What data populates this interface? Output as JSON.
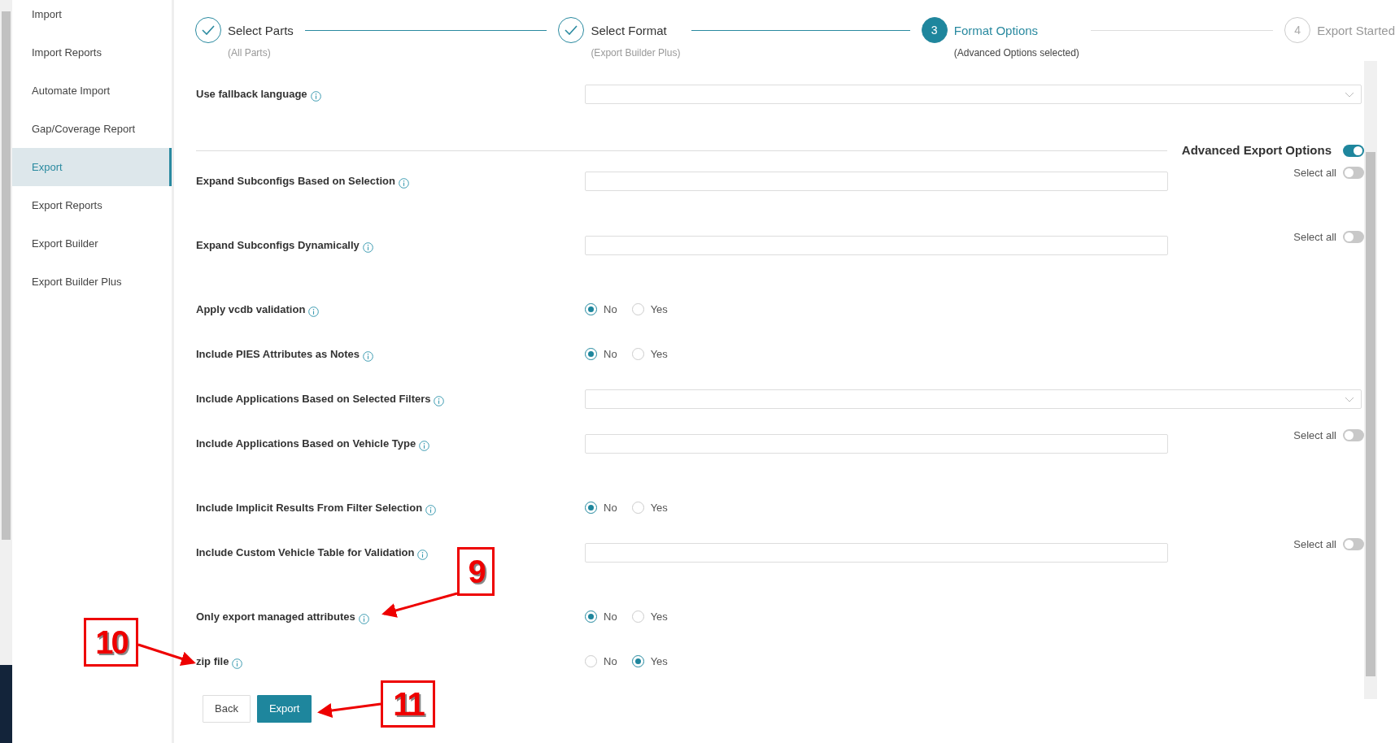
{
  "sidebar": {
    "items": [
      {
        "label": "Import",
        "selected": false
      },
      {
        "label": "Import Reports",
        "selected": false
      },
      {
        "label": "Automate Import",
        "selected": false
      },
      {
        "label": "Gap/Coverage Report",
        "selected": false
      },
      {
        "label": "Export",
        "selected": true
      },
      {
        "label": "Export Reports",
        "selected": false
      },
      {
        "label": "Export Builder",
        "selected": false
      },
      {
        "label": "Export Builder Plus",
        "selected": false
      }
    ]
  },
  "steps": [
    {
      "label": "Select Parts",
      "sublabel": "(All Parts)",
      "kind": "done"
    },
    {
      "label": "Select Format",
      "sublabel": "(Export Builder Plus)",
      "kind": "done"
    },
    {
      "number": "3",
      "label": "Format Options",
      "sublabel": "(Advanced Options selected)",
      "kind": "current"
    },
    {
      "number": "4",
      "label": "Export Started",
      "kind": "todo"
    }
  ],
  "fallback": {
    "label": "Use fallback language",
    "kind": "select"
  },
  "advanced": {
    "label": "Advanced Export Options",
    "on": true
  },
  "options": [
    {
      "label": "Expand Subconfigs Based on Selection",
      "kind": "text",
      "select_all": {
        "label": "Select all",
        "on": false
      }
    },
    {
      "label": "Expand Subconfigs Dynamically",
      "kind": "text",
      "select_all": {
        "label": "Select all",
        "on": false
      }
    },
    {
      "label": "Apply vcdb validation",
      "kind": "radio",
      "choices": [
        {
          "label": "No",
          "selected": true
        },
        {
          "label": "Yes",
          "selected": false
        }
      ]
    },
    {
      "label": "Include PIES Attributes as Notes",
      "kind": "radio",
      "choices": [
        {
          "label": "No",
          "selected": true
        },
        {
          "label": "Yes",
          "selected": false
        }
      ]
    },
    {
      "label": "Include Applications Based on Selected Filters",
      "kind": "select"
    },
    {
      "label": "Include Applications Based on Vehicle Type",
      "kind": "text",
      "select_all": {
        "label": "Select all",
        "on": false
      }
    },
    {
      "label": "Include Implicit Results From Filter Selection",
      "kind": "radio",
      "choices": [
        {
          "label": "No",
          "selected": true
        },
        {
          "label": "Yes",
          "selected": false
        }
      ]
    },
    {
      "label": "Include Custom Vehicle Table for Validation",
      "kind": "text",
      "select_all": {
        "label": "Select all",
        "on": false
      }
    },
    {
      "label": "Only export managed attributes",
      "kind": "radio",
      "choices": [
        {
          "label": "No",
          "selected": true
        },
        {
          "label": "Yes",
          "selected": false
        }
      ]
    },
    {
      "label": "zip file",
      "kind": "radio",
      "choices": [
        {
          "label": "No",
          "selected": false
        },
        {
          "label": "Yes",
          "selected": true
        }
      ]
    }
  ],
  "buttons": [
    {
      "label": "Back",
      "kind": "secondary"
    },
    {
      "label": "Export",
      "kind": "primary"
    }
  ],
  "annotations": [
    {
      "label": "9"
    },
    {
      "label": "10"
    },
    {
      "label": "11"
    }
  ]
}
